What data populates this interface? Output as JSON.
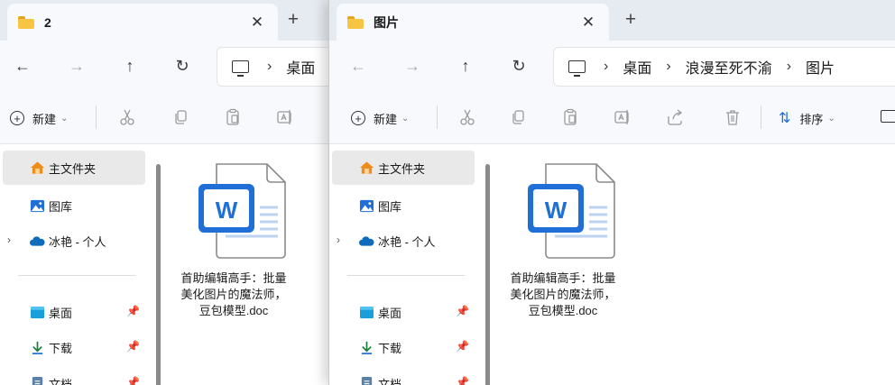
{
  "windows": [
    {
      "tab_title": "2",
      "breadcrumb": [
        "桌面"
      ],
      "new_label": "新建",
      "sort_label": "",
      "sidebar": {
        "home": "主文件夹",
        "gallery": "图库",
        "onedrive": "冰艳 - 个人",
        "desktop": "桌面",
        "downloads": "下载",
        "documents": "文档"
      },
      "file": {
        "name": "首助编辑高手：批量美化图片的魔法师，豆包模型.doc"
      }
    },
    {
      "tab_title": "图片",
      "breadcrumb": [
        "桌面",
        "浪漫至死不渝",
        "图片"
      ],
      "new_label": "新建",
      "sort_label": "排序",
      "sidebar": {
        "home": "主文件夹",
        "gallery": "图库",
        "onedrive": "冰艳 - 个人",
        "desktop": "桌面",
        "downloads": "下载",
        "documents": "文档"
      },
      "file": {
        "name": "首助编辑高手：批量美化图片的魔法师，豆包模型.doc"
      }
    }
  ],
  "icons": {
    "tab_close": "close-icon",
    "new_tab": "plus-icon",
    "back": "arrow-left-icon",
    "forward": "arrow-right-icon",
    "up": "arrow-up-icon",
    "refresh": "refresh-icon",
    "this_pc": "monitor-icon",
    "cut": "scissors-icon",
    "copy": "copy-icon",
    "paste": "clipboard-icon",
    "rename": "rename-icon",
    "share": "share-icon",
    "delete": "trash-icon",
    "home": "home-icon",
    "gallery": "gallery-icon",
    "onedrive": "cloud-icon",
    "desktop": "desktop-folder-icon",
    "downloads": "download-icon",
    "documents": "document-icon",
    "pin": "pin-icon",
    "word_file": "word-doc-icon"
  },
  "colors": {
    "tabstrip": "#e6ebf1",
    "toolbar": "#f7f9fc",
    "folder": "#f7c542",
    "word_blue": "#1f6fd6",
    "home_orange": "#f08c1c",
    "cloud": "#0f6cbd"
  }
}
